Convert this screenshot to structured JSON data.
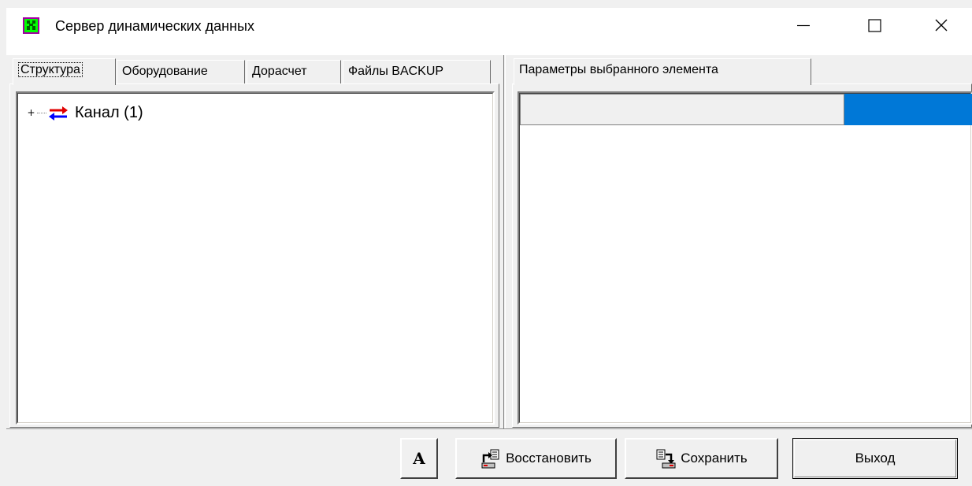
{
  "window": {
    "title": "Сервер динамических данных",
    "controls": {
      "minimize": "—",
      "maximize": "☐",
      "close": "✕"
    }
  },
  "left_tabs": [
    {
      "label": "Структура",
      "active": true
    },
    {
      "label": "Оборудование",
      "active": false
    },
    {
      "label": "Дорасчет",
      "active": false
    },
    {
      "label": "Файлы BACKUP",
      "active": false
    }
  ],
  "tree": {
    "items": [
      {
        "label": "Канал (1)",
        "expander": "+",
        "icon": "channel-arrows-icon"
      }
    ]
  },
  "right_tabs": [
    {
      "label": "Параметры выбранного элемента",
      "active": true
    }
  ],
  "buttons": {
    "font": "A",
    "restore": "Восстановить",
    "save": "Сохранить",
    "exit": "Выход"
  },
  "colors": {
    "accent_blue": "#0078d7",
    "icon_red": "#e00000",
    "icon_blue": "#0000ff"
  }
}
